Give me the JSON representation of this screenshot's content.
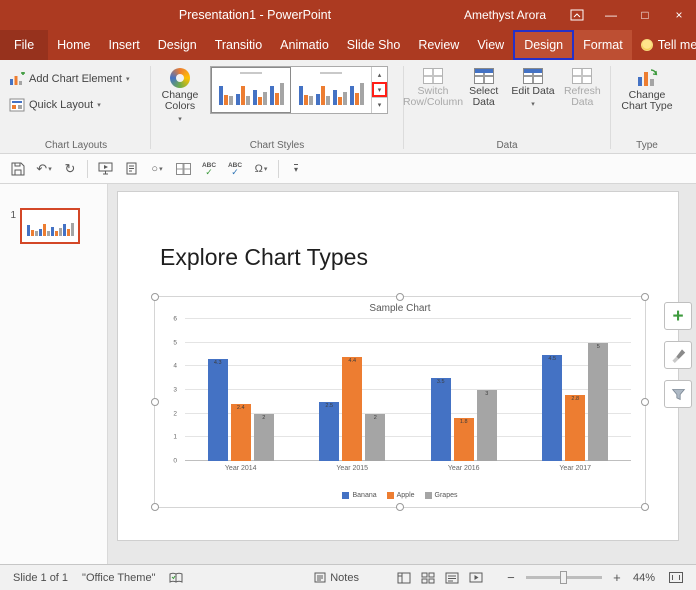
{
  "titlebar": {
    "title": "Presentation1 - PowerPoint",
    "user": "Amethyst Arora"
  },
  "glyphs": {
    "caret": "▾",
    "undo": "↶",
    "redo": "↻",
    "gallery_up": "▴",
    "gallery_down": "▾",
    "gallery_more": "▾",
    "minimize": "—",
    "maximize": "□",
    "close": "×",
    "zoom_out": "−",
    "zoom_in": "+",
    "abc": "ABC",
    "check": "✓",
    "circle": "○",
    "omega": "Ω",
    "qat_more": "▾"
  },
  "ribbon": {
    "tabs": [
      "File",
      "Home",
      "Insert",
      "Design",
      "Transitio",
      "Animatio",
      "Slide Sho",
      "Review",
      "View",
      "Design",
      "Format",
      "Tell me"
    ],
    "chart_layouts": {
      "group_label": "Chart Layouts",
      "add_chart_element": "Add Chart Element",
      "quick_layout": "Quick Layout"
    },
    "chart_styles": {
      "group_label": "Chart Styles",
      "change_colors": "Change Colors"
    },
    "data": {
      "group_label": "Data",
      "switch_row_column": "Switch Row/Column",
      "select_data": "Select Data",
      "edit_data": "Edit Data",
      "refresh_data": "Refresh Data"
    },
    "type": {
      "group_label": "Type",
      "change_chart_type": "Change Chart Type"
    }
  },
  "slide_panel": {
    "slide_number": "1"
  },
  "slide": {
    "title": "Explore Chart Types"
  },
  "status_bar": {
    "slide_indicator": "Slide 1 of 1",
    "theme_name": "\"Office Theme\"",
    "notes_label": "Notes",
    "zoom_percent": "44%"
  },
  "colors": {
    "titlebar_red": "#AC3A21",
    "annotation_blue": "#2430C8",
    "annotation_red": "#FF1F17",
    "thumbnail_selection": "#D34727",
    "chart_elements_green": "#3E9B3E"
  },
  "chart_data": {
    "type": "bar",
    "title": "Sample Chart",
    "categories": [
      "Year 2014",
      "Year 2015",
      "Year 2016",
      "Year 2017"
    ],
    "series": [
      {
        "name": "Banana",
        "color": "#4472C4",
        "values": [
          4.3,
          2.5,
          3.5,
          4.5
        ]
      },
      {
        "name": "Apple",
        "color": "#ED7D31",
        "values": [
          2.4,
          4.4,
          1.8,
          2.8
        ]
      },
      {
        "name": "Grapes",
        "color": "#A5A5A5",
        "values": [
          2,
          2,
          3,
          5
        ]
      }
    ],
    "ylim": [
      0,
      6
    ],
    "yticks": [
      0,
      1,
      2,
      3,
      4,
      5,
      6
    ],
    "grid": true,
    "legend_position": "bottom",
    "data_labels": true
  }
}
